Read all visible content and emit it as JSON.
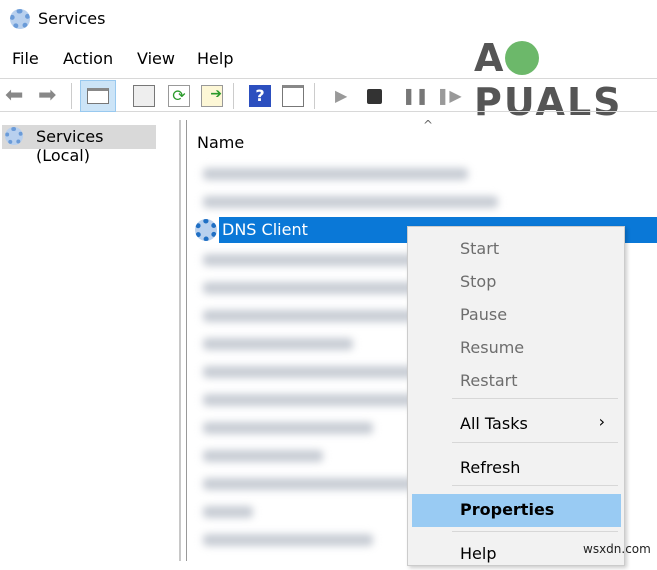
{
  "window": {
    "title": "Services",
    "icon": "services-gear-icon"
  },
  "menubar": [
    "File",
    "Action",
    "View",
    "Help"
  ],
  "toolbar": [
    "back",
    "forward",
    "show-hide-console-tree",
    "properties",
    "refresh",
    "export-list",
    "help",
    "show-hide-action-pane",
    "start-service",
    "stop-service",
    "pause-service",
    "resume-service"
  ],
  "tree": {
    "item": "Services (Local)"
  },
  "list": {
    "column": "Name",
    "selected": "DNS Client"
  },
  "context_menu": {
    "items": [
      {
        "label": "Start",
        "disabled": true
      },
      {
        "label": "Stop",
        "disabled": true
      },
      {
        "label": "Pause",
        "disabled": true
      },
      {
        "label": "Resume",
        "disabled": true
      },
      {
        "label": "Restart",
        "disabled": true
      },
      {
        "label": "All Tasks",
        "submenu": true
      },
      {
        "label": "Refresh"
      },
      {
        "label": "Properties",
        "highlighted": true
      },
      {
        "label": "Help"
      }
    ],
    "submenu_arrow": "›"
  },
  "watermarks": {
    "logo": "APPUALS",
    "site": "wsxdn.com"
  },
  "colors": {
    "selection": "#0a78d7",
    "menu_highlight": "#99cbf3"
  }
}
